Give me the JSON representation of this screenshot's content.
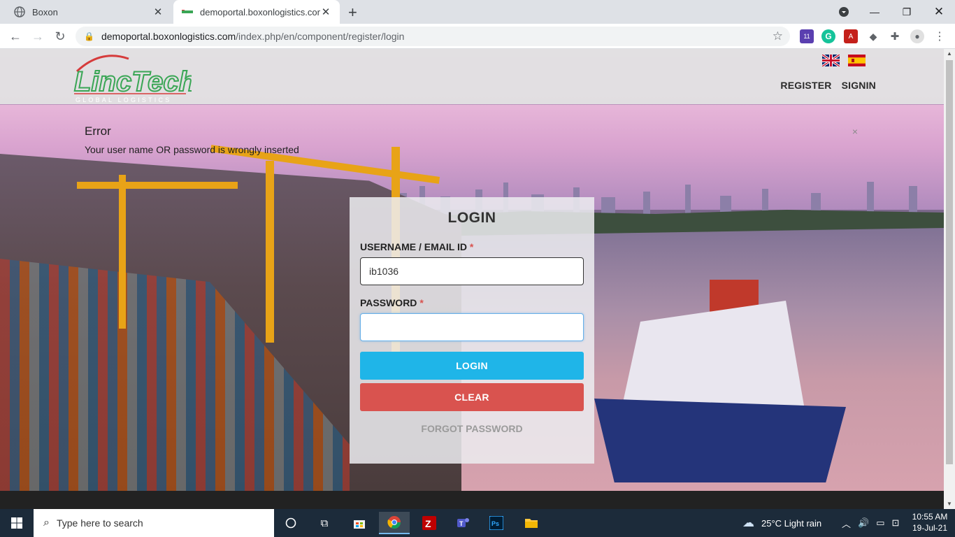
{
  "browser": {
    "tabs": [
      {
        "title": "Boxon",
        "active": false
      },
      {
        "title": "demoportal.boxonlogistics.com",
        "active": true
      }
    ],
    "url_host": "demoportal.boxonlogistics.com",
    "url_path": "/index.php/en/component/register/login",
    "extension_badge": "11"
  },
  "site": {
    "logo_text": "LincTech",
    "logo_subtext": "GLOBAL LOGISTICS",
    "nav": {
      "register": "REGISTER",
      "signin": "SIGNIN"
    }
  },
  "alert": {
    "title": "Error",
    "message": "Your user name OR password is wrongly inserted",
    "close": "×"
  },
  "login": {
    "title": "LOGIN",
    "username_label": "USERNAME / EMAIL ID",
    "username_value": "ib1036",
    "password_label": "PASSWORD",
    "password_value": "",
    "required_mark": "*",
    "login_button": "LOGIN",
    "clear_button": "CLEAR",
    "forgot_link": "FORGOT PASSWORD"
  },
  "taskbar": {
    "search_placeholder": "Type here to search",
    "weather": "25°C  Light rain",
    "time": "10:55 AM",
    "date": "19-Jul-21"
  },
  "colors": {
    "login_btn": "#1fb5e8",
    "clear_btn": "#d9534f",
    "logo_green": "#3aa655",
    "logo_red": "#d63b3b"
  }
}
